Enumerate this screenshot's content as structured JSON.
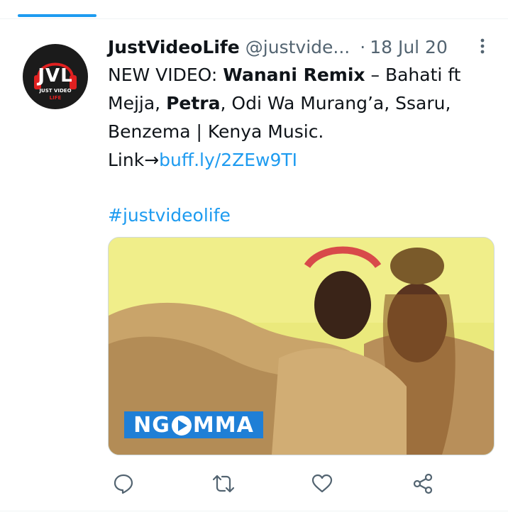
{
  "tweet": {
    "display_name": "JustVideoLife",
    "handle": "@justvide...",
    "separator": "·",
    "date": "18 Jul 20",
    "text": {
      "line_prefix": "NEW VIDEO: ",
      "title_bold": "Wanani Remix",
      "dash_text": " – Bahati ft Mejja, ",
      "petra_bold": "Petra",
      "rest": ", Odi Wa Murang’a, Ssaru, Benzema | Kenya Music.",
      "link_label": "Link→",
      "link_url": "buff.ly/2ZEw9TI"
    },
    "hashtag": "#justvideolife"
  },
  "avatar": {
    "big": "JVL",
    "line1": "JUST VIDEO",
    "line2": "LIFE"
  },
  "media": {
    "logo_left": "NG",
    "logo_right": "MMA"
  },
  "actions": {
    "reply_icon": "reply-icon",
    "retweet_icon": "retweet-icon",
    "like_icon": "like-icon",
    "share_icon": "share-icon"
  },
  "colors": {
    "accent": "#1d9bf0",
    "secondary_text": "#536471",
    "logo_bg": "#1f7fd6"
  }
}
